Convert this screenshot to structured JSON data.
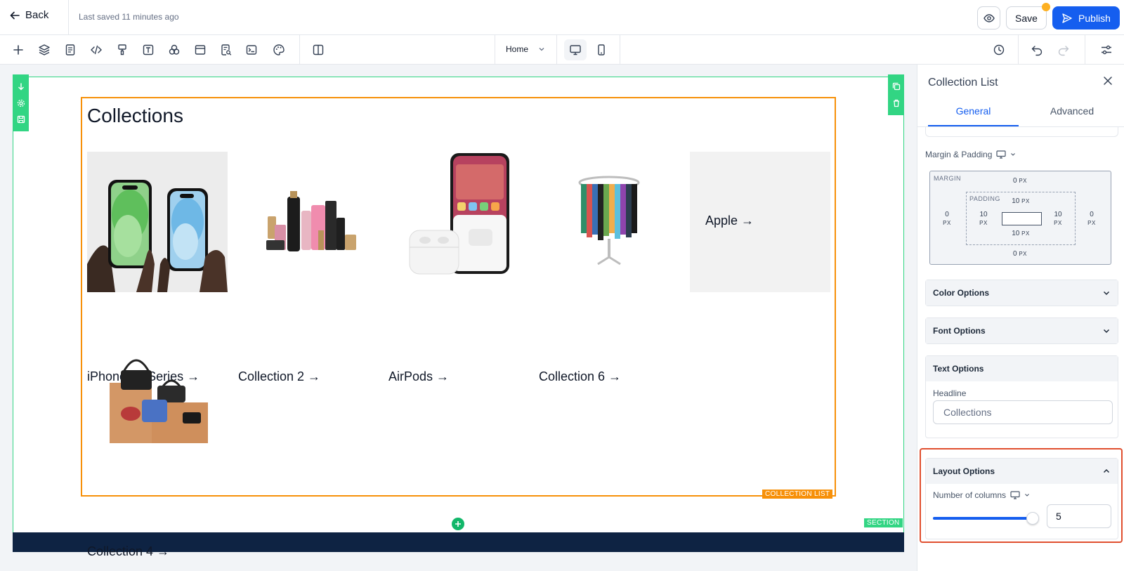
{
  "header": {
    "back_label": "Back",
    "last_saved": "Last saved 11 minutes ago",
    "save_label": "Save",
    "publish_label": "Publish"
  },
  "toolbar": {
    "tools": [
      "add-icon",
      "layers-icon",
      "pages-icon",
      "code-icon",
      "paint-icon",
      "text-icon",
      "components-icon",
      "layout-icon",
      "seo-icon",
      "terminal-icon",
      "palette-icon",
      "split-view-icon"
    ],
    "page_select": "Home",
    "devices": [
      "desktop-icon",
      "mobile-icon"
    ],
    "right_tools": [
      "history-icon",
      "undo-icon",
      "redo-icon",
      "settings-sliders-icon"
    ]
  },
  "canvas": {
    "heading": "Collections",
    "collection_list_tag": "COLLECTION LIST",
    "section_tag": "SECTION",
    "collections": [
      {
        "label": "iPhone 15 Series →"
      },
      {
        "label": "Collection 2 →"
      },
      {
        "label": "AirPods →"
      },
      {
        "label": "Collection 6 →"
      },
      {
        "label": "Apple →"
      },
      {
        "label": "Collection 4 →"
      }
    ]
  },
  "panel": {
    "title": "Collection List",
    "tabs": [
      "General",
      "Advanced"
    ],
    "margin_padding_label": "Margin & Padding",
    "margin_tag": "MARGIN",
    "padding_tag": "PADDING",
    "margin": {
      "top": "0",
      "right": "0",
      "bottom": "0",
      "left": "0"
    },
    "padding": {
      "top": "10",
      "right": "10",
      "bottom": "10",
      "left": "10"
    },
    "unit": "PX",
    "color_options": "Color Options",
    "font_options": "Font Options",
    "text_options": "Text Options",
    "headline_label": "Headline",
    "headline_value": "Collections",
    "layout_options": "Layout Options",
    "columns_label": "Number of columns",
    "columns_value": "5",
    "columns_slider_fraction": 1.0
  },
  "colors": {
    "accent": "#155eef",
    "section_outline": "#32d583",
    "collection_outline": "#f79009",
    "highlight": "#e04f2f",
    "footer": "#0e2343"
  }
}
